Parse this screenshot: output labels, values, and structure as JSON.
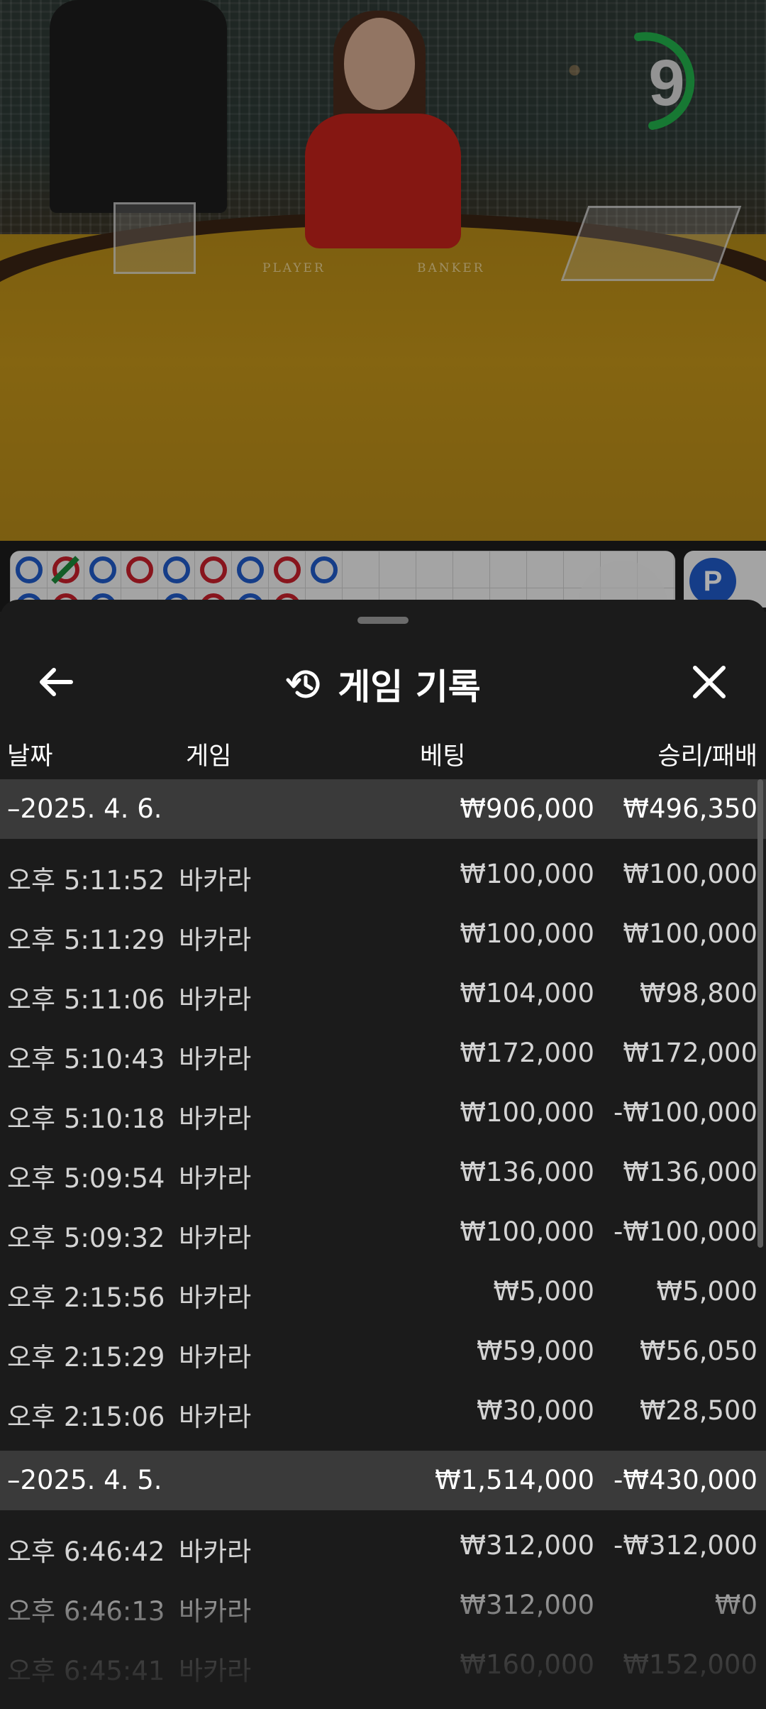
{
  "video": {
    "timer": "9",
    "felt_label_player": "PLAYER",
    "felt_label_banker": "BANKER"
  },
  "roadmap": {
    "badge": "P"
  },
  "sheet": {
    "title": "게임 기록",
    "columns": {
      "date": "날짜",
      "game": "게임",
      "bet": "베팅",
      "winloss": "승리/패배"
    },
    "groups": [
      {
        "date": "–2025. 4. 6.",
        "bet": "₩906,000",
        "winloss": "₩496,350",
        "rows": [
          {
            "time": "오후 5:11:52",
            "game": "바카라",
            "bet": "₩100,000",
            "winloss": "₩100,000"
          },
          {
            "time": "오후 5:11:29",
            "game": "바카라",
            "bet": "₩100,000",
            "winloss": "₩100,000"
          },
          {
            "time": "오후 5:11:06",
            "game": "바카라",
            "bet": "₩104,000",
            "winloss": "₩98,800"
          },
          {
            "time": "오후 5:10:43",
            "game": "바카라",
            "bet": "₩172,000",
            "winloss": "₩172,000"
          },
          {
            "time": "오후 5:10:18",
            "game": "바카라",
            "bet": "₩100,000",
            "winloss": "-₩100,000"
          },
          {
            "time": "오후 5:09:54",
            "game": "바카라",
            "bet": "₩136,000",
            "winloss": "₩136,000"
          },
          {
            "time": "오후 5:09:32",
            "game": "바카라",
            "bet": "₩100,000",
            "winloss": "-₩100,000"
          },
          {
            "time": "오후 2:15:56",
            "game": "바카라",
            "bet": "₩5,000",
            "winloss": "₩5,000"
          },
          {
            "time": "오후 2:15:29",
            "game": "바카라",
            "bet": "₩59,000",
            "winloss": "₩56,050"
          },
          {
            "time": "오후 2:15:06",
            "game": "바카라",
            "bet": "₩30,000",
            "winloss": "₩28,500"
          }
        ]
      },
      {
        "date": "–2025. 4. 5.",
        "bet": "₩1,514,000",
        "winloss": "-₩430,000",
        "rows": [
          {
            "time": "오후 6:46:42",
            "game": "바카라",
            "bet": "₩312,000",
            "winloss": "-₩312,000"
          },
          {
            "time": "오후 6:46:13",
            "game": "바카라",
            "bet": "₩312,000",
            "winloss": "₩0"
          },
          {
            "time": "오후 6:45:41",
            "game": "바카라",
            "bet": "₩160,000",
            "winloss": "₩152,000"
          }
        ]
      }
    ]
  }
}
